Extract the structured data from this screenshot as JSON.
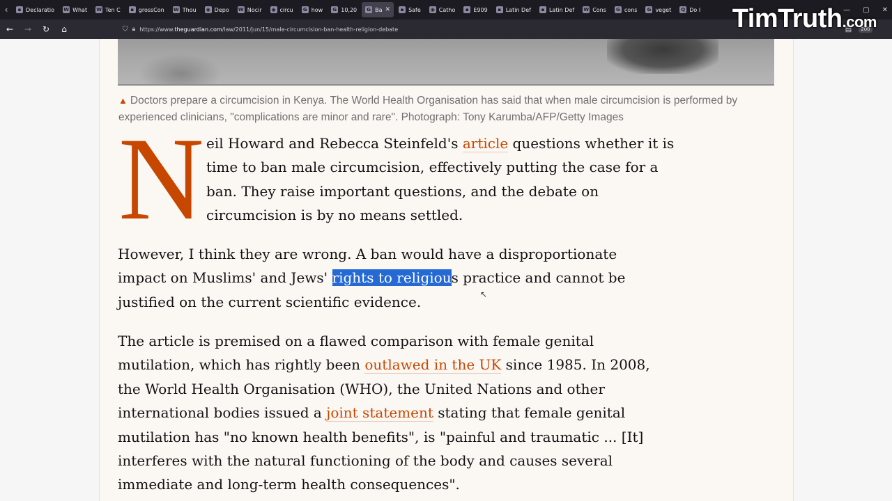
{
  "browser": {
    "tabs": [
      {
        "label": "Declaratio",
        "icon": "doc-icon"
      },
      {
        "label": "What",
        "icon": "w-icon"
      },
      {
        "label": "Ten C",
        "icon": "w-icon"
      },
      {
        "label": "grossCon",
        "icon": "doc-icon"
      },
      {
        "label": "Thou",
        "icon": "w-icon"
      },
      {
        "label": "Depo",
        "icon": "globe-icon"
      },
      {
        "label": "Nocir",
        "icon": "w-icon"
      },
      {
        "label": "circu",
        "icon": "globe-icon"
      },
      {
        "label": "how",
        "icon": "google-icon"
      },
      {
        "label": "10,20",
        "icon": "google-icon"
      },
      {
        "label": "Ba",
        "icon": "guardian-icon",
        "active": true
      },
      {
        "label": "Safe",
        "icon": "doc-icon"
      },
      {
        "label": "Catho",
        "icon": "globe-icon"
      },
      {
        "label": "E909",
        "icon": "doc-icon"
      },
      {
        "label": "Latin Def",
        "icon": "doc-icon"
      },
      {
        "label": "Latin Def",
        "icon": "doc-icon"
      },
      {
        "label": "Cons",
        "icon": "w-icon"
      },
      {
        "label": "cons",
        "icon": "google-icon"
      },
      {
        "label": "veget",
        "icon": "google-icon"
      },
      {
        "label": "Do I",
        "icon": "quora-icon"
      }
    ],
    "url_prefix": "https://www.",
    "url_host": "theguardian.com",
    "url_path": "/law/2011/jun/15/male-circumcision-ban-health-religion-debate",
    "zoom": "200"
  },
  "watermark": {
    "name": "TimTruth",
    "tld": ".com"
  },
  "article": {
    "caption": "Doctors prepare a circumcision in Kenya. The World Health Organisation has said that when male circumcision is performed by experienced clinicians, \"complications are minor and rare\". Photograph: Tony Karumba/AFP/Getty Images",
    "caption_line1": "Doctors prepare a circumcision in Kenya. The World Health Organisation has said that when male circumcision is performed by",
    "caption_line2": "experienced clinicians, \"complications are minor and rare\". Photograph: Tony Karumba/AFP/Getty Images",
    "dropcap": "N",
    "p1": {
      "l1_a": "eil Howard and Rebecca Steinfeld's ",
      "l1_link": "article",
      "l1_b": " questions whether it is",
      "l2": "time to ban male circumcision, effectively putting the case for a",
      "l3": "ban. They raise important questions, and the debate on",
      "l4": "circumcision is by no means settled."
    },
    "p2": {
      "l1": "However, I think they are wrong. A ban would have a disproportionate",
      "l2_a": "impact on Muslims' and Jews' ",
      "l2_sel": "rights to religiou",
      "l2_b": "s practice and cannot be",
      "l3": "justified on the current scientific evidence."
    },
    "p3": {
      "l1": "The article is premised on a flawed comparison with female genital",
      "l2_a": "mutilation, which has rightly been ",
      "l2_link": "outlawed in the UK",
      "l2_b": " since 1985. In 2008,",
      "l3": "the World Health Organisation (WHO), the United Nations and other",
      "l4_a": "international bodies issued a ",
      "l4_link": "joint statement",
      "l4_b": " stating that female genital",
      "l5": "mutilation has \"no known health benefits\", is \"painful and traumatic ... [It]",
      "l6": "interferes with the natural functioning of the body and causes several",
      "l7": "immediate and long-term health consequences\"."
    }
  },
  "colors": {
    "accent": "#c74600",
    "selection": "#2469d4",
    "text": "#121212",
    "caption": "#707070"
  }
}
